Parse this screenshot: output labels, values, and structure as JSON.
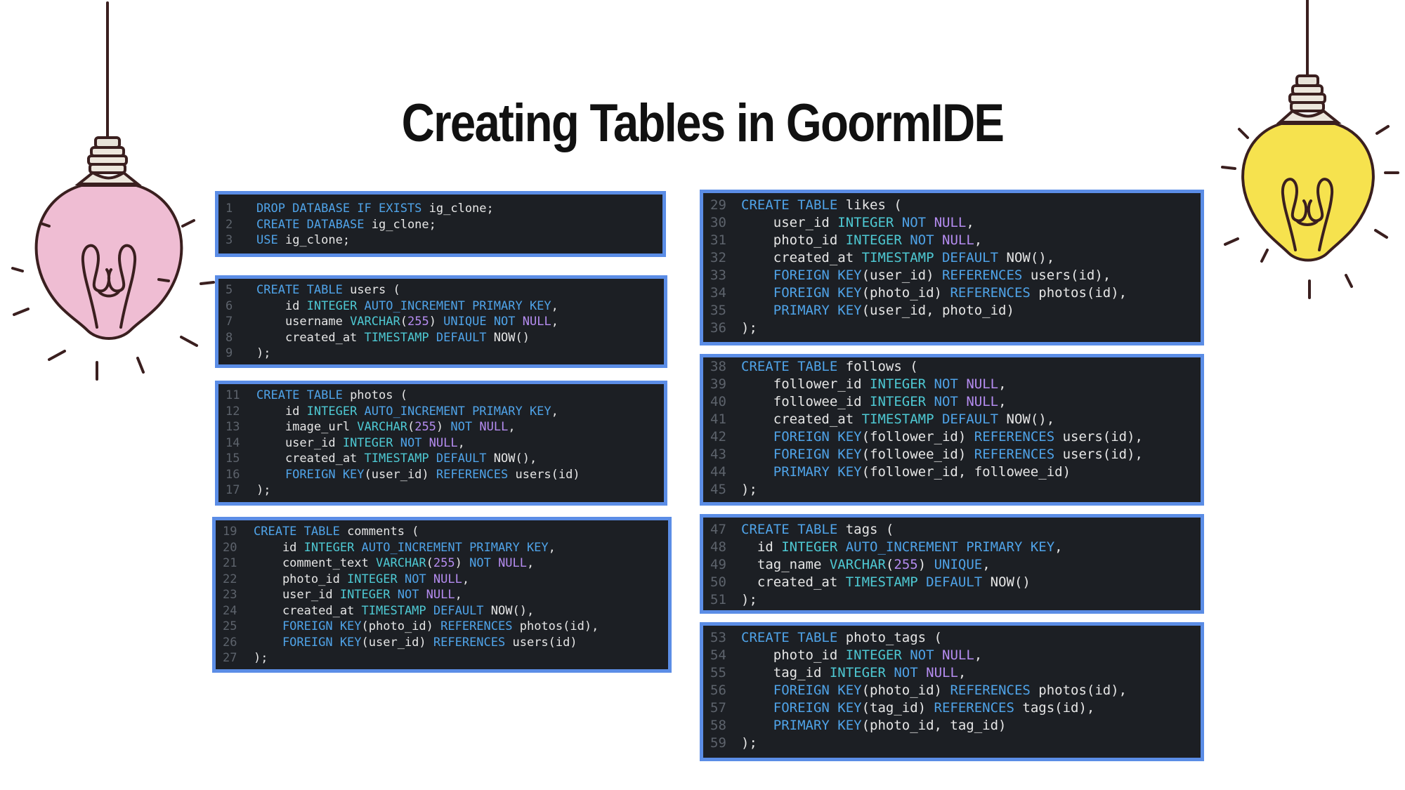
{
  "title": "Creating Tables in GoormIDE",
  "colors": {
    "panel_background": "#1c1f24",
    "panel_border": "#5b8de6",
    "keyword": "#4fa3e8",
    "type": "#4ec9d3",
    "constraint": "#b58cf0",
    "plain_text": "#e6e6e6",
    "line_number": "#5d636c",
    "bulb_left": "#efbdd3",
    "bulb_right": "#f6e24e"
  },
  "icons": {
    "left": "lightbulb-icon",
    "right": "lightbulb-icon"
  },
  "panels": [
    {
      "name": "database",
      "lines": [
        {
          "n": "1",
          "t": [
            [
              "k",
              "DROP DATABASE IF EXISTS "
            ],
            [
              "p",
              "ig_clone;"
            ]
          ]
        },
        {
          "n": "2",
          "t": [
            [
              "k",
              "CREATE DATABASE "
            ],
            [
              "p",
              "ig_clone;"
            ]
          ]
        },
        {
          "n": "3",
          "t": [
            [
              "k",
              "USE "
            ],
            [
              "p",
              "ig_clone;"
            ]
          ]
        }
      ]
    },
    {
      "name": "users",
      "lines": [
        {
          "n": "5",
          "t": [
            [
              "k",
              "CREATE TABLE "
            ],
            [
              "p",
              "users ("
            ]
          ]
        },
        {
          "n": "6",
          "t": [
            [
              "p",
              "    id "
            ],
            [
              "t",
              "INTEGER "
            ],
            [
              "k",
              "AUTO_INCREMENT PRIMARY KEY"
            ],
            [
              "p",
              ","
            ]
          ]
        },
        {
          "n": "7",
          "t": [
            [
              "p",
              "    username "
            ],
            [
              "t",
              "VARCHAR"
            ],
            [
              "p",
              "("
            ],
            [
              "c",
              "255"
            ],
            [
              "p",
              ") "
            ],
            [
              "k",
              "UNIQUE NOT "
            ],
            [
              "c",
              "NULL"
            ],
            [
              "p",
              ","
            ]
          ]
        },
        {
          "n": "8",
          "t": [
            [
              "p",
              "    created_at "
            ],
            [
              "t",
              "TIMESTAMP "
            ],
            [
              "k",
              "DEFAULT "
            ],
            [
              "p",
              "NOW()"
            ]
          ]
        },
        {
          "n": "9",
          "t": [
            [
              "p",
              ");"
            ]
          ]
        }
      ]
    },
    {
      "name": "photos",
      "lines": [
        {
          "n": "11",
          "t": [
            [
              "k",
              "CREATE TABLE "
            ],
            [
              "p",
              "photos ("
            ]
          ]
        },
        {
          "n": "12",
          "t": [
            [
              "p",
              "    id "
            ],
            [
              "t",
              "INTEGER "
            ],
            [
              "k",
              "AUTO_INCREMENT PRIMARY KEY"
            ],
            [
              "p",
              ","
            ]
          ]
        },
        {
          "n": "13",
          "t": [
            [
              "p",
              "    image_url "
            ],
            [
              "t",
              "VARCHAR"
            ],
            [
              "p",
              "("
            ],
            [
              "c",
              "255"
            ],
            [
              "p",
              ") "
            ],
            [
              "k",
              "NOT "
            ],
            [
              "c",
              "NULL"
            ],
            [
              "p",
              ","
            ]
          ]
        },
        {
          "n": "14",
          "t": [
            [
              "p",
              "    user_id "
            ],
            [
              "t",
              "INTEGER "
            ],
            [
              "k",
              "NOT "
            ],
            [
              "c",
              "NULL"
            ],
            [
              "p",
              ","
            ]
          ]
        },
        {
          "n": "15",
          "t": [
            [
              "p",
              "    created_at "
            ],
            [
              "t",
              "TIMESTAMP "
            ],
            [
              "k",
              "DEFAULT "
            ],
            [
              "p",
              "NOW(),"
            ]
          ]
        },
        {
          "n": "16",
          "t": [
            [
              "k",
              "    FOREIGN KEY"
            ],
            [
              "p",
              "(user_id) "
            ],
            [
              "k",
              "REFERENCES "
            ],
            [
              "p",
              "users(id)"
            ]
          ]
        },
        {
          "n": "17",
          "t": [
            [
              "p",
              ");"
            ]
          ]
        }
      ]
    },
    {
      "name": "comments",
      "lines": [
        {
          "n": "19",
          "t": [
            [
              "k",
              "CREATE TABLE "
            ],
            [
              "p",
              "comments ("
            ]
          ]
        },
        {
          "n": "20",
          "t": [
            [
              "p",
              "    id "
            ],
            [
              "t",
              "INTEGER "
            ],
            [
              "k",
              "AUTO_INCREMENT PRIMARY KEY"
            ],
            [
              "p",
              ","
            ]
          ]
        },
        {
          "n": "21",
          "t": [
            [
              "p",
              "    comment_text "
            ],
            [
              "t",
              "VARCHAR"
            ],
            [
              "p",
              "("
            ],
            [
              "c",
              "255"
            ],
            [
              "p",
              ") "
            ],
            [
              "k",
              "NOT "
            ],
            [
              "c",
              "NULL"
            ],
            [
              "p",
              ","
            ]
          ]
        },
        {
          "n": "22",
          "t": [
            [
              "p",
              "    photo_id "
            ],
            [
              "t",
              "INTEGER "
            ],
            [
              "k",
              "NOT "
            ],
            [
              "c",
              "NULL"
            ],
            [
              "p",
              ","
            ]
          ]
        },
        {
          "n": "23",
          "t": [
            [
              "p",
              "    user_id "
            ],
            [
              "t",
              "INTEGER "
            ],
            [
              "k",
              "NOT "
            ],
            [
              "c",
              "NULL"
            ],
            [
              "p",
              ","
            ]
          ]
        },
        {
          "n": "24",
          "t": [
            [
              "p",
              "    created_at "
            ],
            [
              "t",
              "TIMESTAMP "
            ],
            [
              "k",
              "DEFAULT "
            ],
            [
              "p",
              "NOW(),"
            ]
          ]
        },
        {
          "n": "25",
          "t": [
            [
              "k",
              "    FOREIGN KEY"
            ],
            [
              "p",
              "(photo_id) "
            ],
            [
              "k",
              "REFERENCES "
            ],
            [
              "p",
              "photos(id),"
            ]
          ]
        },
        {
          "n": "26",
          "t": [
            [
              "k",
              "    FOREIGN KEY"
            ],
            [
              "p",
              "(user_id) "
            ],
            [
              "k",
              "REFERENCES "
            ],
            [
              "p",
              "users(id)"
            ]
          ]
        },
        {
          "n": "27",
          "t": [
            [
              "p",
              ");"
            ]
          ]
        }
      ]
    },
    {
      "name": "likes",
      "lines": [
        {
          "n": "29",
          "t": [
            [
              "k",
              "CREATE TABLE "
            ],
            [
              "p",
              "likes ("
            ]
          ]
        },
        {
          "n": "30",
          "t": [
            [
              "p",
              "    user_id "
            ],
            [
              "t",
              "INTEGER "
            ],
            [
              "k",
              "NOT "
            ],
            [
              "c",
              "NULL"
            ],
            [
              "p",
              ","
            ]
          ]
        },
        {
          "n": "31",
          "t": [
            [
              "p",
              "    photo_id "
            ],
            [
              "t",
              "INTEGER "
            ],
            [
              "k",
              "NOT "
            ],
            [
              "c",
              "NULL"
            ],
            [
              "p",
              ","
            ]
          ]
        },
        {
          "n": "32",
          "t": [
            [
              "p",
              "    created_at "
            ],
            [
              "t",
              "TIMESTAMP "
            ],
            [
              "k",
              "DEFAULT "
            ],
            [
              "p",
              "NOW(),"
            ]
          ]
        },
        {
          "n": "33",
          "t": [
            [
              "k",
              "    FOREIGN KEY"
            ],
            [
              "p",
              "(user_id) "
            ],
            [
              "k",
              "REFERENCES "
            ],
            [
              "p",
              "users(id),"
            ]
          ]
        },
        {
          "n": "34",
          "t": [
            [
              "k",
              "    FOREIGN KEY"
            ],
            [
              "p",
              "(photo_id) "
            ],
            [
              "k",
              "REFERENCES "
            ],
            [
              "p",
              "photos(id),"
            ]
          ]
        },
        {
          "n": "35",
          "t": [
            [
              "k",
              "    PRIMARY KEY"
            ],
            [
              "p",
              "(user_id, photo_id)"
            ]
          ]
        },
        {
          "n": "36",
          "t": [
            [
              "p",
              ");"
            ]
          ]
        }
      ]
    },
    {
      "name": "follows",
      "lines": [
        {
          "n": "38",
          "t": [
            [
              "k",
              "CREATE TABLE "
            ],
            [
              "p",
              "follows ("
            ]
          ]
        },
        {
          "n": "39",
          "t": [
            [
              "p",
              "    follower_id "
            ],
            [
              "t",
              "INTEGER "
            ],
            [
              "k",
              "NOT "
            ],
            [
              "c",
              "NULL"
            ],
            [
              "p",
              ","
            ]
          ]
        },
        {
          "n": "40",
          "t": [
            [
              "p",
              "    followee_id "
            ],
            [
              "t",
              "INTEGER "
            ],
            [
              "k",
              "NOT "
            ],
            [
              "c",
              "NULL"
            ],
            [
              "p",
              ","
            ]
          ]
        },
        {
          "n": "41",
          "t": [
            [
              "p",
              "    created_at "
            ],
            [
              "t",
              "TIMESTAMP "
            ],
            [
              "k",
              "DEFAULT "
            ],
            [
              "p",
              "NOW(),"
            ]
          ]
        },
        {
          "n": "42",
          "t": [
            [
              "k",
              "    FOREIGN KEY"
            ],
            [
              "p",
              "(follower_id) "
            ],
            [
              "k",
              "REFERENCES "
            ],
            [
              "p",
              "users(id),"
            ]
          ]
        },
        {
          "n": "43",
          "t": [
            [
              "k",
              "    FOREIGN KEY"
            ],
            [
              "p",
              "(followee_id) "
            ],
            [
              "k",
              "REFERENCES "
            ],
            [
              "p",
              "users(id),"
            ]
          ]
        },
        {
          "n": "44",
          "t": [
            [
              "k",
              "    PRIMARY KEY"
            ],
            [
              "p",
              "(follower_id, followee_id)"
            ]
          ]
        },
        {
          "n": "45",
          "t": [
            [
              "p",
              ");"
            ]
          ]
        }
      ]
    },
    {
      "name": "tags",
      "lines": [
        {
          "n": "47",
          "t": [
            [
              "k",
              "CREATE TABLE "
            ],
            [
              "p",
              "tags ("
            ]
          ]
        },
        {
          "n": "48",
          "t": [
            [
              "p",
              "  id "
            ],
            [
              "t",
              "INTEGER "
            ],
            [
              "k",
              "AUTO_INCREMENT PRIMARY KEY"
            ],
            [
              "p",
              ","
            ]
          ]
        },
        {
          "n": "49",
          "t": [
            [
              "p",
              "  tag_name "
            ],
            [
              "t",
              "VARCHAR"
            ],
            [
              "p",
              "("
            ],
            [
              "c",
              "255"
            ],
            [
              "p",
              ") "
            ],
            [
              "k",
              "UNIQUE"
            ],
            [
              "p",
              ","
            ]
          ]
        },
        {
          "n": "50",
          "t": [
            [
              "p",
              "  created_at "
            ],
            [
              "t",
              "TIMESTAMP "
            ],
            [
              "k",
              "DEFAULT "
            ],
            [
              "p",
              "NOW()"
            ]
          ]
        },
        {
          "n": "51",
          "t": [
            [
              "p",
              ");"
            ]
          ]
        }
      ]
    },
    {
      "name": "photo-tags",
      "lines": [
        {
          "n": "53",
          "t": [
            [
              "k",
              "CREATE TABLE "
            ],
            [
              "p",
              "photo_tags ("
            ]
          ]
        },
        {
          "n": "54",
          "t": [
            [
              "p",
              "    photo_id "
            ],
            [
              "t",
              "INTEGER "
            ],
            [
              "k",
              "NOT "
            ],
            [
              "c",
              "NULL"
            ],
            [
              "p",
              ","
            ]
          ]
        },
        {
          "n": "55",
          "t": [
            [
              "p",
              "    tag_id "
            ],
            [
              "t",
              "INTEGER "
            ],
            [
              "k",
              "NOT "
            ],
            [
              "c",
              "NULL"
            ],
            [
              "p",
              ","
            ]
          ]
        },
        {
          "n": "56",
          "t": [
            [
              "k",
              "    FOREIGN KEY"
            ],
            [
              "p",
              "(photo_id) "
            ],
            [
              "k",
              "REFERENCES "
            ],
            [
              "p",
              "photos(id),"
            ]
          ]
        },
        {
          "n": "57",
          "t": [
            [
              "k",
              "    FOREIGN KEY"
            ],
            [
              "p",
              "(tag_id) "
            ],
            [
              "k",
              "REFERENCES "
            ],
            [
              "p",
              "tags(id),"
            ]
          ]
        },
        {
          "n": "58",
          "t": [
            [
              "k",
              "    PRIMARY KEY"
            ],
            [
              "p",
              "(photo_id, tag_id)"
            ]
          ]
        },
        {
          "n": "59",
          "t": [
            [
              "p",
              ");"
            ]
          ]
        }
      ]
    }
  ]
}
